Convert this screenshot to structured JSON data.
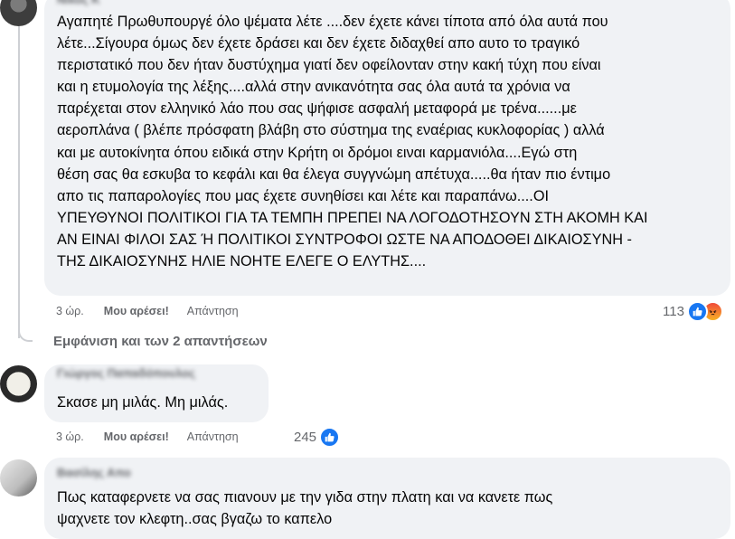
{
  "comments": [
    {
      "author": "Νίκος Κ",
      "text": "Αγαπητέ Πρωθυπουργέ όλο ψέματα λέτε ....δεν έχετε κάνει τίποτα από όλα αυτά που\nλέτε...Σίγουρα όμως δεν έχετε δράσει και δεν έχετε διδαχθεί απο αυτο το τραγικό\nπεριστατικό που δεν ήταν δυστύχημα γιατί δεν οφείλονταν στην κακή τύχη που είναι\nκαι η ετυμολογία της λέξης....αλλά στην ανικανότητα σας όλα αυτά τα χρόνια να\nπαρέχεται στον ελληνικό λάο που σας ψήφισε ασφαλή μεταφορά με τρένα......με\nαεροπλάνα ( βλέπε πρόσφατη βλάβη στο σύστημα της εναέριας κυκλοφορίας ) αλλά\nκαι με αυτοκίνητα όπου ειδικά στην Κρήτη οι δρόμοι ειναι καρμανιόλα....Εγώ στη\nθέση σας θα εσκυβα το κεφάλι και θα έλεγα συγγνώμη απέτυχα.....θα ήταν πιο έντιμο\nαπο τις παπαρολογίες που μας έχετε συνηθίσει και λέτε και παραπάνω....ΟΙ\nΥΠΕΥΘΥΝΟΙ ΠΟΛΙΤΙΚΟΙ ΓΙΑ ΤΑ ΤΕΜΠΗ ΠΡΕΠΕΙ ΝΑ ΛΟΓΟΔΟΤΗΣΟΥΝ ΣΤΗ ΑΚΟΜΗ ΚΑΙ\nΑΝ ΕΙΝΑΙ ΦΙΛΟΙ ΣΑΣ Ή ΠΟΛΙΤΙΚΟΙ ΣΥΝΤΡΟΦΟΙ ΩΣΤΕ ΝΑ ΑΠΟΔΟΘΕΙ ΔΙΚΑΙΟΣΥΝΗ -\nΤΗΣ ΔΙΚΑΙΟΣΥΝΗΣ ΗΛΙΕ ΝΟΗΤΕ ΕΛΕΓΕ Ο ΕΛΥΤΗΣ....",
      "time": "3 ώρ.",
      "like_label": "Μου αρέσει!",
      "reply_label": "Απάντηση",
      "reaction_count": "113",
      "reactions": [
        "like-icon",
        "angry-icon"
      ]
    },
    {
      "author": "Γιώργος Παπαδόπουλος",
      "text": "Σκασε μη μιλάς. Μη μιλάς.",
      "time": "3 ώρ.",
      "like_label": "Μου αρέσει!",
      "reply_label": "Απάντηση",
      "reaction_count": "245",
      "reactions": [
        "like-icon"
      ]
    },
    {
      "author": "Βασίλης Απο",
      "text": "Πως καταφερνετε να σας πιανουν με την γιδα στην πλατη και να κανετε πως\nψαχνετε τον κλεφτη..σας βγαζω το καπελο",
      "time": "",
      "like_label": "",
      "reply_label": "",
      "reaction_count": "",
      "reactions": []
    }
  ],
  "view_replies_label": "Εμφάνιση και των 2 απαντήσεων",
  "colors": {
    "bubble": "#f0f2f5",
    "secondary_text": "#65676b",
    "like_blue": "#1877f2",
    "thread_line": "#ced0d4"
  }
}
